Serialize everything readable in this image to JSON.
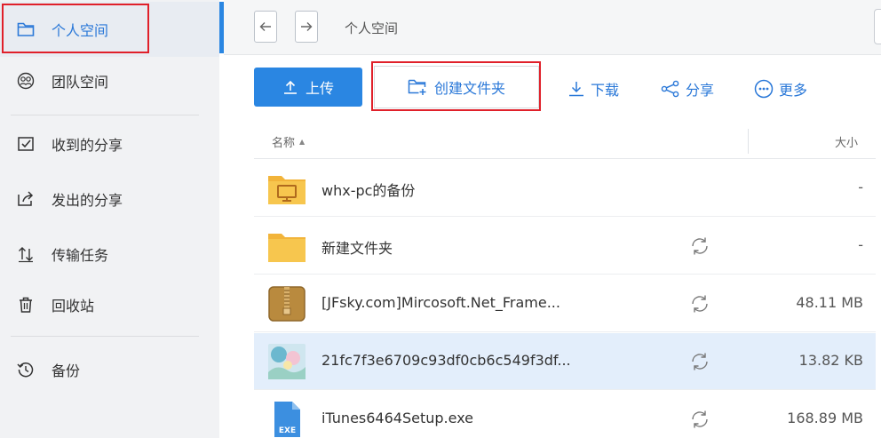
{
  "sidebar": {
    "items": [
      {
        "label": "个人空间",
        "icon": "folder-icon"
      },
      {
        "label": "团队空间",
        "icon": "team-icon"
      },
      {
        "label": "收到的分享",
        "icon": "inbox-icon"
      },
      {
        "label": "发出的分享",
        "icon": "share-out-icon"
      },
      {
        "label": "传输任务",
        "icon": "transfer-icon"
      },
      {
        "label": "回收站",
        "icon": "trash-icon"
      },
      {
        "label": "备份",
        "icon": "backup-icon"
      }
    ]
  },
  "topbar": {
    "breadcrumb": "个人空间"
  },
  "toolbar": {
    "upload_label": "上传",
    "create_folder_label": "创建文件夹",
    "download_label": "下载",
    "share_label": "分享",
    "more_label": "更多"
  },
  "table": {
    "col_name": "名称",
    "col_size": "大小",
    "sort_indicator": "▲",
    "rows": [
      {
        "name": "whx-pc的备份",
        "size": "-",
        "type": "backup-folder",
        "sync": false,
        "selected": false
      },
      {
        "name": "新建文件夹",
        "size": "-",
        "type": "folder",
        "sync": true,
        "selected": false
      },
      {
        "name": "[JFsky.com]Mircosoft.Net_Frame...",
        "size": "48.11 MB",
        "type": "archive",
        "sync": true,
        "selected": false
      },
      {
        "name": "21fc7f3e6709c93df0cb6c549f3df...",
        "size": "13.82 KB",
        "type": "image",
        "sync": true,
        "selected": true
      },
      {
        "name": "iTunes6464Setup.exe",
        "size": "168.89 MB",
        "type": "exe",
        "sync": true,
        "selected": false
      }
    ]
  },
  "exe_badge": "EXE",
  "colors": {
    "accent": "#2a86e2",
    "highlight_box": "#e0202a",
    "sidebar_bg": "#f1f2f4",
    "selected_row": "#e3eefb"
  }
}
